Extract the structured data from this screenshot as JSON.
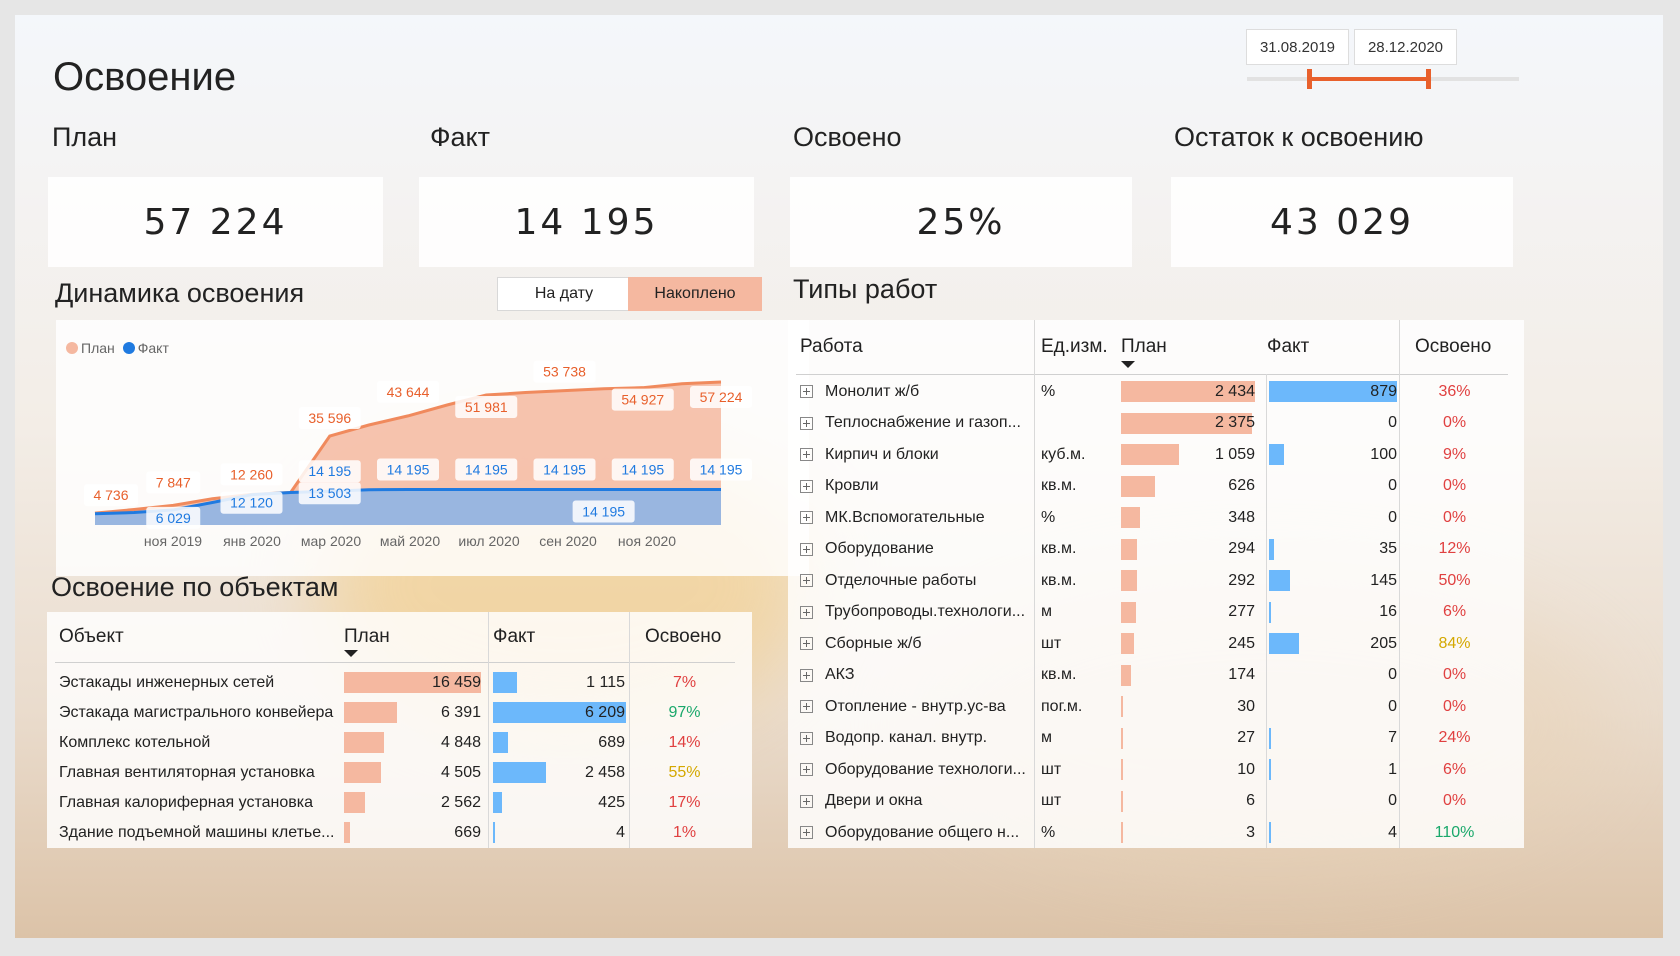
{
  "page_title": "Освоение",
  "date_range": {
    "start": "31.08.2019",
    "end": "28.12.2020"
  },
  "kpis": [
    {
      "label": "План",
      "value": "57 224"
    },
    {
      "label": "Факт",
      "value": "14 195"
    },
    {
      "label": "Освоено",
      "value": "25%"
    },
    {
      "label": "Остаток к освоению",
      "value": "43 029"
    }
  ],
  "dynamics": {
    "title": "Динамика освоения",
    "toggle": {
      "on_date": "На дату",
      "cumulative": "Накоплено"
    },
    "legend": {
      "plan": "План",
      "fact": "Факт"
    }
  },
  "colors": {
    "plan": "#f5b8a0",
    "plan_line": "#f08a5d",
    "fact": "#6cb8fb",
    "fact_line": "#1f7ae0",
    "accent": "#e8602c",
    "green": "#1aa86b",
    "yellow": "#d4a800",
    "red": "#e04040"
  },
  "chart_data": {
    "type": "area",
    "x_ticks": [
      "ноя 2019",
      "янв 2020",
      "мар 2020",
      "май 2020",
      "июл 2020",
      "сен 2020",
      "ноя 2020"
    ],
    "series": [
      {
        "name": "План",
        "points": [
          4736,
          6200,
          7847,
          10500,
          12260,
          13000,
          35596,
          40000,
          43644,
          48000,
          51981,
          53000,
          53738,
          54500,
          54927,
          56500,
          57224
        ]
      },
      {
        "name": "Факт",
        "points": [
          4500,
          5000,
          6029,
          9000,
          12120,
          13000,
          13503,
          14100,
          14195,
          14195,
          14195,
          14195,
          14195,
          14195,
          14195,
          14195,
          14195
        ]
      }
    ],
    "plan_labels": [
      {
        "i": 0,
        "text": "4 736"
      },
      {
        "i": 2,
        "text": "7 847"
      },
      {
        "i": 4,
        "text": "12 260"
      },
      {
        "i": 6,
        "text": "35 596"
      },
      {
        "i": 8,
        "text": "43 644"
      },
      {
        "i": 10,
        "text": "51 981"
      },
      {
        "i": 12,
        "text": "53 738"
      },
      {
        "i": 14,
        "text": "54 927"
      },
      {
        "i": 16,
        "text": "57 224"
      }
    ],
    "fact_labels": [
      {
        "i": 2,
        "text": "6 029"
      },
      {
        "i": 4,
        "text": "12 120"
      },
      {
        "i": 6,
        "text": "14 195"
      },
      {
        "i": 6,
        "text": "13 503"
      },
      {
        "i": 8,
        "text": "14 195"
      },
      {
        "i": 10,
        "text": "14 195"
      },
      {
        "i": 12,
        "text": "14 195"
      },
      {
        "i": 14,
        "text": "14 195"
      },
      {
        "i": 16,
        "text": "14 195"
      }
    ],
    "ylim": [
      0,
      60000
    ]
  },
  "objects": {
    "title": "Освоение по объектам",
    "headers": {
      "object": "Объект",
      "plan": "План",
      "fact": "Факт",
      "done": "Освоено"
    },
    "max_plan": 16459,
    "max_fact": 6209,
    "rows": [
      {
        "name": "Эстакады инженерных сетей",
        "plan": "16 459",
        "plan_v": 16459,
        "fact": "1 115",
        "fact_v": 1115,
        "pct": "7%",
        "level": "red"
      },
      {
        "name": "Эстакада магистрального конвейера",
        "plan": "6 391",
        "plan_v": 6391,
        "fact": "6 209",
        "fact_v": 6209,
        "pct": "97%",
        "level": "green"
      },
      {
        "name": "Комплекс котельной",
        "plan": "4 848",
        "plan_v": 4848,
        "fact": "689",
        "fact_v": 689,
        "pct": "14%",
        "level": "red"
      },
      {
        "name": "Главная вентиляторная установка",
        "plan": "4 505",
        "plan_v": 4505,
        "fact": "2 458",
        "fact_v": 2458,
        "pct": "55%",
        "level": "yellow"
      },
      {
        "name": "Главная калориферная установка",
        "plan": "2 562",
        "plan_v": 2562,
        "fact": "425",
        "fact_v": 425,
        "pct": "17%",
        "level": "red"
      },
      {
        "name": "Здание подъемной машины клетье...",
        "plan": "669",
        "plan_v": 669,
        "fact": "4",
        "fact_v": 4,
        "pct": "1%",
        "level": "red"
      }
    ]
  },
  "work_types": {
    "title": "Типы работ",
    "headers": {
      "work": "Работа",
      "unit": "Ед.изм.",
      "plan": "План",
      "fact": "Факт",
      "done": "Освоено"
    },
    "max_plan": 2434,
    "max_fact": 879,
    "rows": [
      {
        "name": "Монолит ж/б",
        "unit": "%",
        "plan": "2 434",
        "plan_v": 2434,
        "fact": "879",
        "fact_v": 879,
        "pct": "36%",
        "level": "red"
      },
      {
        "name": "Теплоснабжение и газоп...",
        "unit": "",
        "plan": "2 375",
        "plan_v": 2375,
        "fact": "0",
        "fact_v": 0,
        "pct": "0%",
        "level": "red"
      },
      {
        "name": "Кирпич и блоки",
        "unit": "куб.м.",
        "plan": "1 059",
        "plan_v": 1059,
        "fact": "100",
        "fact_v": 100,
        "pct": "9%",
        "level": "red"
      },
      {
        "name": "Кровли",
        "unit": "кв.м.",
        "plan": "626",
        "plan_v": 626,
        "fact": "0",
        "fact_v": 0,
        "pct": "0%",
        "level": "red"
      },
      {
        "name": "МК.Вспомогательные",
        "unit": "%",
        "plan": "348",
        "plan_v": 348,
        "fact": "0",
        "fact_v": 0,
        "pct": "0%",
        "level": "red"
      },
      {
        "name": "Оборудование",
        "unit": "кв.м.",
        "plan": "294",
        "plan_v": 294,
        "fact": "35",
        "fact_v": 35,
        "pct": "12%",
        "level": "red"
      },
      {
        "name": "Отделочные работы",
        "unit": "кв.м.",
        "plan": "292",
        "plan_v": 292,
        "fact": "145",
        "fact_v": 145,
        "pct": "50%",
        "level": "red"
      },
      {
        "name": "Трубопроводы.технологи...",
        "unit": "м",
        "plan": "277",
        "plan_v": 277,
        "fact": "16",
        "fact_v": 16,
        "pct": "6%",
        "level": "red"
      },
      {
        "name": "Сборные ж/б",
        "unit": "шт",
        "plan": "245",
        "plan_v": 245,
        "fact": "205",
        "fact_v": 205,
        "pct": "84%",
        "level": "yellow"
      },
      {
        "name": "АКЗ",
        "unit": "кв.м.",
        "plan": "174",
        "plan_v": 174,
        "fact": "0",
        "fact_v": 0,
        "pct": "0%",
        "level": "red"
      },
      {
        "name": "Отопление - внутр.ус-ва",
        "unit": "пог.м.",
        "plan": "30",
        "plan_v": 30,
        "fact": "0",
        "fact_v": 0,
        "pct": "0%",
        "level": "red"
      },
      {
        "name": "Водопр. канал. внутр.",
        "unit": "м",
        "plan": "27",
        "plan_v": 27,
        "fact": "7",
        "fact_v": 7,
        "pct": "24%",
        "level": "red"
      },
      {
        "name": "Оборудование технологи...",
        "unit": "шт",
        "plan": "10",
        "plan_v": 10,
        "fact": "1",
        "fact_v": 1,
        "pct": "6%",
        "level": "red"
      },
      {
        "name": "Двери и окна",
        "unit": "шт",
        "plan": "6",
        "plan_v": 6,
        "fact": "0",
        "fact_v": 0,
        "pct": "0%",
        "level": "red"
      },
      {
        "name": "Оборудование общего н...",
        "unit": "%",
        "plan": "3",
        "plan_v": 3,
        "fact": "4",
        "fact_v": 4,
        "pct": "110%",
        "level": "green"
      }
    ]
  }
}
